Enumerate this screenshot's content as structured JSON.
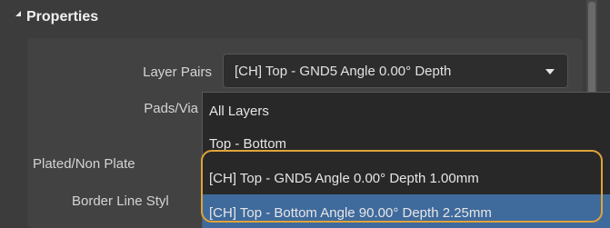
{
  "section": {
    "title": "Properties",
    "collapse_icon": "triangle-down-icon"
  },
  "fields": {
    "layer_pairs_label": "Layer Pairs",
    "pads_via_label": "Pads/Via",
    "plated_label": "Plated/Non Plate",
    "border_label": "Border Line Styl"
  },
  "combo": {
    "value": "[CH] Top - GND5 Angle 0.00° Depth",
    "arrow_icon": "chevron-down-icon"
  },
  "dropdown": {
    "options": [
      "All Layers",
      "Top - Bottom",
      "[CH] Top - GND5 Angle 0.00° Depth 1.00mm",
      "[CH] Top - Bottom Angle 90.00° Depth 2.25mm"
    ],
    "highlighted_index": 3
  },
  "colors": {
    "highlight": "#3f6a9c",
    "callout": "#e0a33a"
  }
}
